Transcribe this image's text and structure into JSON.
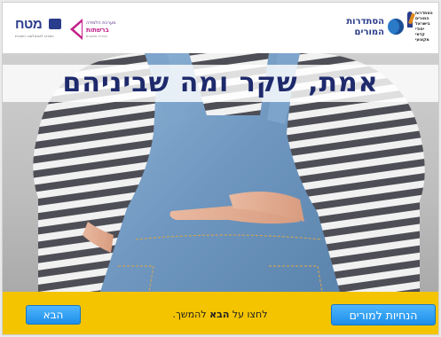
{
  "header": {
    "logo_mateh": {
      "word": "מטח",
      "sub": "המרכז לטכנולוגיה חינוכית"
    },
    "logo_curriculum": {
      "line1": "מערכת הלמידה",
      "line2": "ברשתות",
      "line3": "ספריית משאבים"
    },
    "logo_histadrut": {
      "line1": "הסתדרות",
      "line2": "המורים"
    },
    "logo_unit": {
      "lines": [
        "הסתדרות",
        "המורים",
        "בישראל",
        "יסודי",
        "קדמי",
        "מקצועי"
      ]
    }
  },
  "main": {
    "title": "אמת, שקר ומה שביניהם",
    "image_description_icon": "crossed-fingers-behind-back-photo"
  },
  "footer": {
    "next_label": "הבא",
    "instruction_prefix": "לחצו על ",
    "instruction_bold": "הבא",
    "instruction_suffix": " להמשך.",
    "guide_label": "הנחיות למורים"
  },
  "colors": {
    "footer_bg": "#f5c400",
    "button_blue": "#1e8ee8",
    "title_navy": "#1e2a6c"
  }
}
